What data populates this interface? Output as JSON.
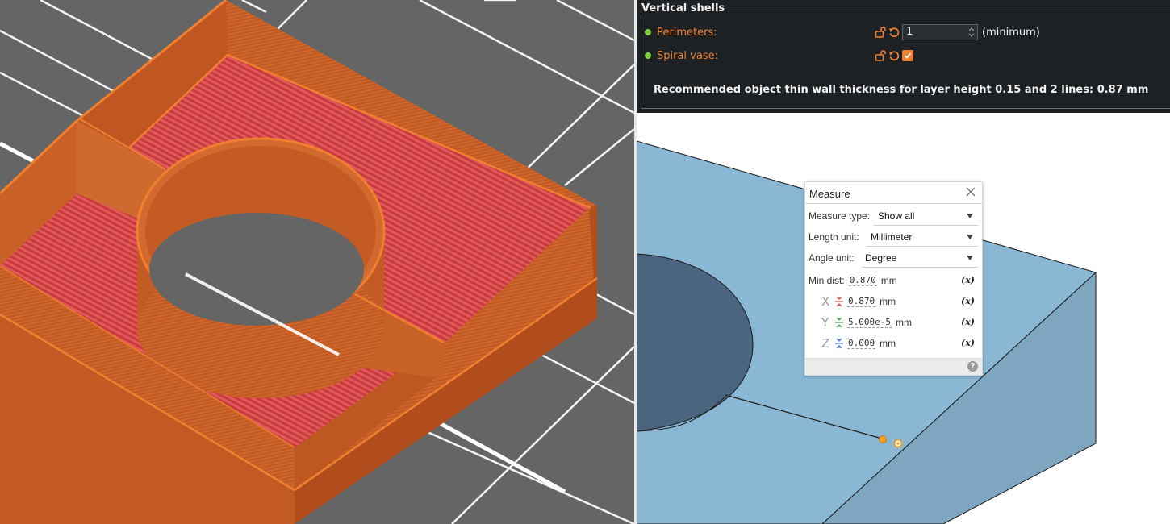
{
  "settings": {
    "section_title": "Vertical shells",
    "perimeters": {
      "label": "Perimeters:",
      "value": "1",
      "suffix": "(minimum)"
    },
    "spiral_vase": {
      "label": "Spiral vase:",
      "checked": true
    },
    "recommendation": "Recommended object thin wall thickness for layer height 0.15 and 2 lines: 0.87 mm"
  },
  "measure": {
    "title": "Measure",
    "measure_type": {
      "label": "Measure type:",
      "value": "Show all"
    },
    "length_unit": {
      "label": "Length unit:",
      "value": "Millimeter"
    },
    "angle_unit": {
      "label": "Angle unit:",
      "value": "Degree"
    },
    "min_dist": {
      "label": "Min dist:",
      "value": "0.870",
      "unit": "mm"
    },
    "x": {
      "label": "X",
      "value": "0.870",
      "unit": "mm"
    },
    "y": {
      "label": "Y",
      "value": "5.000e-5",
      "unit": "mm"
    },
    "z": {
      "label": "Z",
      "value": "0.000",
      "unit": "mm"
    },
    "fx_label": "(x)",
    "help_label": "?"
  },
  "colors": {
    "accent_orange": "#f07f2f",
    "modified_green": "#7dd13a",
    "print_orange": "#d4662a",
    "infill_red": "#d9474a",
    "cad_blue": "#8bb8d4"
  },
  "icons": [
    "lock-open-icon",
    "reset-arrow-icon",
    "close-icon",
    "help-icon",
    "function-icon",
    "distance-icon"
  ]
}
